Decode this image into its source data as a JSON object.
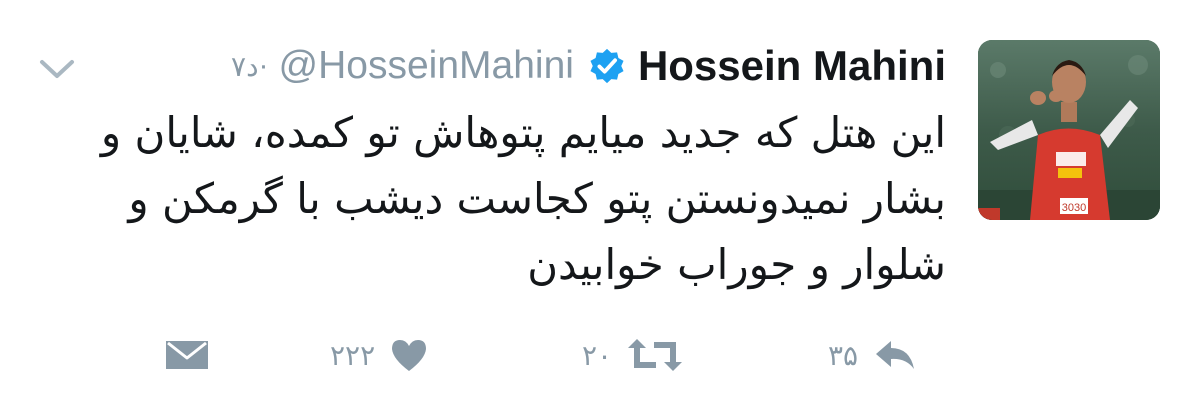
{
  "tweet": {
    "display_name": "Hossein Mahini",
    "handle": "@HosseinMahini",
    "separator": "·",
    "time": "۷د",
    "text_lines": [
      "این هتل که جدید میایم پتوهاش تو کمده،  شایان و",
      "بشار نمیدونستن پتو کجاست دیشب با گرمکن و",
      "شلوار و جوراب خوابیدن"
    ]
  },
  "actions": {
    "reply_count": "۳۵",
    "retweet_count": "۲۰",
    "like_count": "۲۲۲"
  },
  "colors": {
    "verified": "#1da1f2",
    "secondary_text": "#8899a6",
    "primary_text": "#14171a"
  },
  "icons": {
    "verified": "verified-badge-icon",
    "caret": "chevron-down-icon",
    "reply": "reply-icon",
    "retweet": "retweet-icon",
    "like": "heart-icon",
    "dm": "envelope-icon"
  }
}
